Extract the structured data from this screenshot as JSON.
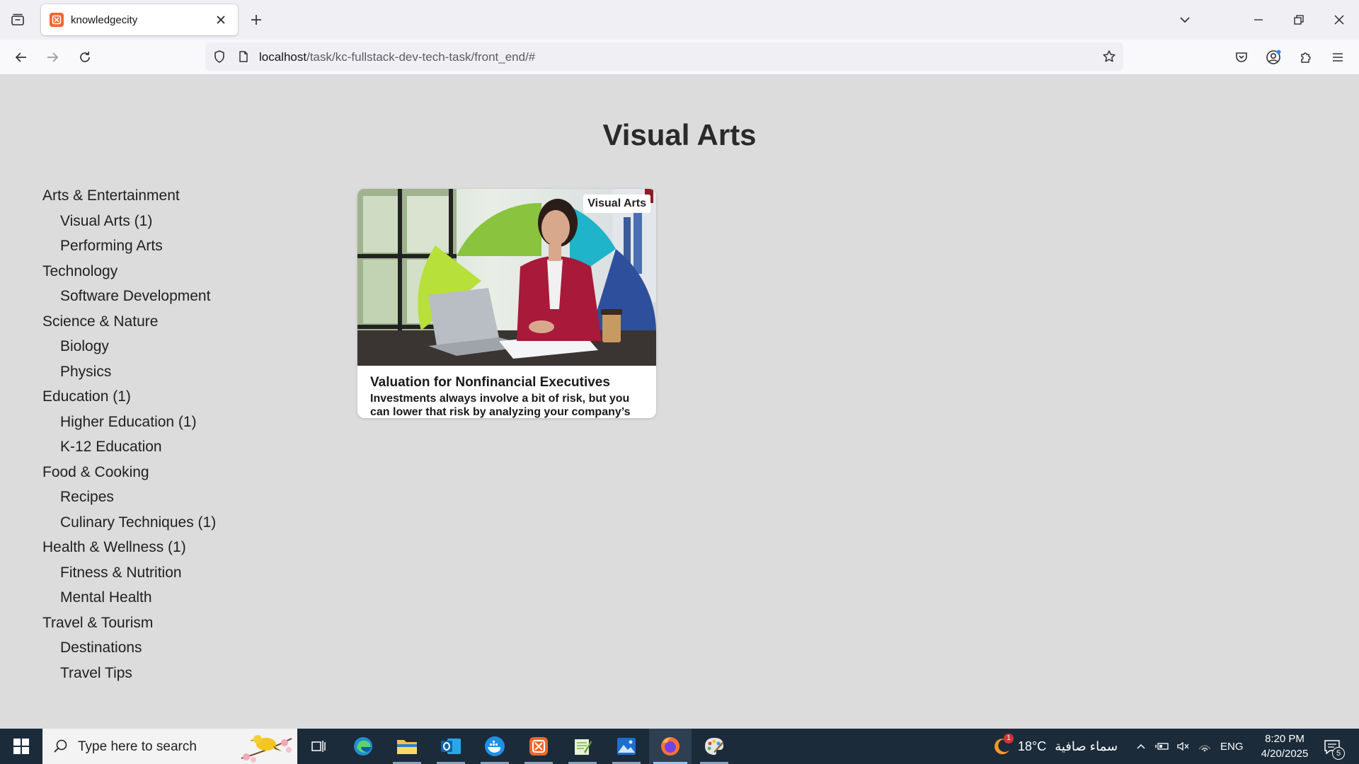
{
  "browser": {
    "tab_title": "knowledgecity",
    "url_host": "localhost",
    "url_path": "/task/kc-fullstack-dev-tech-task/front_end/#"
  },
  "page": {
    "title": "Visual Arts",
    "categories": [
      {
        "label": "Arts & Entertainment",
        "level": 0
      },
      {
        "label": "Visual Arts (1)",
        "level": 1
      },
      {
        "label": "Performing Arts",
        "level": 1
      },
      {
        "label": "Technology",
        "level": 0
      },
      {
        "label": "Software Development",
        "level": 1
      },
      {
        "label": "Science & Nature",
        "level": 0
      },
      {
        "label": "Biology",
        "level": 1
      },
      {
        "label": "Physics",
        "level": 1
      },
      {
        "label": "Education (1)",
        "level": 0
      },
      {
        "label": "Higher Education (1)",
        "level": 1
      },
      {
        "label": "K-12 Education",
        "level": 1
      },
      {
        "label": "Food & Cooking",
        "level": 0
      },
      {
        "label": "Recipes",
        "level": 1
      },
      {
        "label": "Culinary Techniques (1)",
        "level": 1
      },
      {
        "label": "Health & Wellness (1)",
        "level": 0
      },
      {
        "label": "Fitness & Nutrition",
        "level": 1
      },
      {
        "label": "Mental Health",
        "level": 1
      },
      {
        "label": "Travel & Tourism",
        "level": 0
      },
      {
        "label": "Destinations",
        "level": 1
      },
      {
        "label": "Travel Tips",
        "level": 1
      }
    ],
    "course": {
      "badge": "Visual Arts",
      "title": "Valuation for Nonfinancial Executives",
      "description": "Investments always involve a bit of risk, but you can lower that risk by analyzing your company’s"
    }
  },
  "taskbar": {
    "search_placeholder": "Type here to search",
    "weather_temp": "18°C",
    "weather_desc": "سماء صافية",
    "weather_alert": "1",
    "language": "ENG",
    "time": "8:20 PM",
    "date": "4/20/2025",
    "notifications": "5"
  },
  "colors": {
    "brand": "#f2662a",
    "page_bg": "#dcdcdc",
    "taskbar_bg": "#1b2b3a"
  }
}
